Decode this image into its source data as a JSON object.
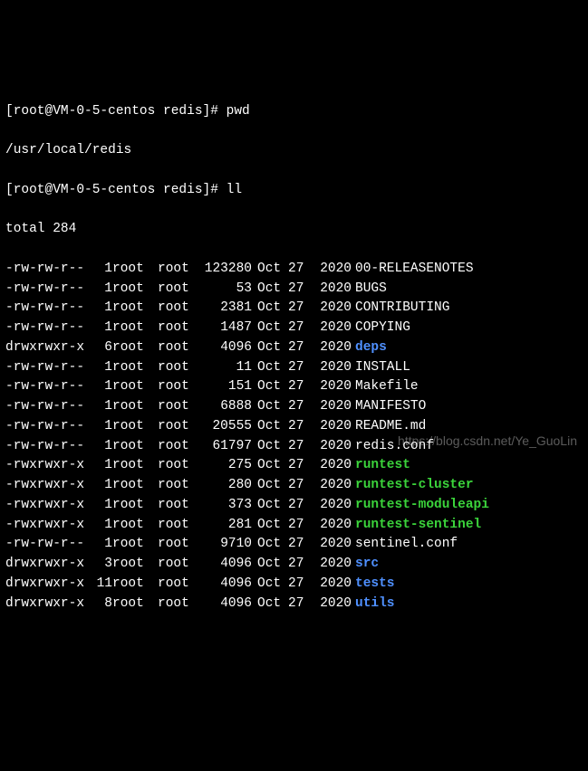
{
  "prompt1": {
    "text": "[root@VM-0-5-centos redis]# ",
    "cmd": "pwd"
  },
  "pwd_output": "/usr/local/redis",
  "prompt2": {
    "text": "[root@VM-0-5-centos redis]# ",
    "cmd": "ll"
  },
  "total_line": "total 284",
  "rows": [
    {
      "perms": "-rw-rw-r--",
      "links": "1",
      "owner": "root",
      "group": "root",
      "size": "123280",
      "month": "Oct",
      "day": "27",
      "year": "2020",
      "name": "00-RELEASENOTES",
      "type": "file"
    },
    {
      "perms": "-rw-rw-r--",
      "links": "1",
      "owner": "root",
      "group": "root",
      "size": "53",
      "month": "Oct",
      "day": "27",
      "year": "2020",
      "name": "BUGS",
      "type": "file"
    },
    {
      "perms": "-rw-rw-r--",
      "links": "1",
      "owner": "root",
      "group": "root",
      "size": "2381",
      "month": "Oct",
      "day": "27",
      "year": "2020",
      "name": "CONTRIBUTING",
      "type": "file"
    },
    {
      "perms": "-rw-rw-r--",
      "links": "1",
      "owner": "root",
      "group": "root",
      "size": "1487",
      "month": "Oct",
      "day": "27",
      "year": "2020",
      "name": "COPYING",
      "type": "file"
    },
    {
      "perms": "drwxrwxr-x",
      "links": "6",
      "owner": "root",
      "group": "root",
      "size": "4096",
      "month": "Oct",
      "day": "27",
      "year": "2020",
      "name": "deps",
      "type": "dir"
    },
    {
      "perms": "-rw-rw-r--",
      "links": "1",
      "owner": "root",
      "group": "root",
      "size": "11",
      "month": "Oct",
      "day": "27",
      "year": "2020",
      "name": "INSTALL",
      "type": "file"
    },
    {
      "perms": "-rw-rw-r--",
      "links": "1",
      "owner": "root",
      "group": "root",
      "size": "151",
      "month": "Oct",
      "day": "27",
      "year": "2020",
      "name": "Makefile",
      "type": "file"
    },
    {
      "perms": "-rw-rw-r--",
      "links": "1",
      "owner": "root",
      "group": "root",
      "size": "6888",
      "month": "Oct",
      "day": "27",
      "year": "2020",
      "name": "MANIFESTO",
      "type": "file"
    },
    {
      "perms": "-rw-rw-r--",
      "links": "1",
      "owner": "root",
      "group": "root",
      "size": "20555",
      "month": "Oct",
      "day": "27",
      "year": "2020",
      "name": "README.md",
      "type": "file"
    },
    {
      "perms": "-rw-rw-r--",
      "links": "1",
      "owner": "root",
      "group": "root",
      "size": "61797",
      "month": "Oct",
      "day": "27",
      "year": "2020",
      "name": "redis.conf",
      "type": "file"
    },
    {
      "perms": "-rwxrwxr-x",
      "links": "1",
      "owner": "root",
      "group": "root",
      "size": "275",
      "month": "Oct",
      "day": "27",
      "year": "2020",
      "name": "runtest",
      "type": "exec"
    },
    {
      "perms": "-rwxrwxr-x",
      "links": "1",
      "owner": "root",
      "group": "root",
      "size": "280",
      "month": "Oct",
      "day": "27",
      "year": "2020",
      "name": "runtest-cluster",
      "type": "exec"
    },
    {
      "perms": "-rwxrwxr-x",
      "links": "1",
      "owner": "root",
      "group": "root",
      "size": "373",
      "month": "Oct",
      "day": "27",
      "year": "2020",
      "name": "runtest-moduleapi",
      "type": "exec"
    },
    {
      "perms": "-rwxrwxr-x",
      "links": "1",
      "owner": "root",
      "group": "root",
      "size": "281",
      "month": "Oct",
      "day": "27",
      "year": "2020",
      "name": "runtest-sentinel",
      "type": "exec"
    },
    {
      "perms": "-rw-rw-r--",
      "links": "1",
      "owner": "root",
      "group": "root",
      "size": "9710",
      "month": "Oct",
      "day": "27",
      "year": "2020",
      "name": "sentinel.conf",
      "type": "file"
    },
    {
      "perms": "drwxrwxr-x",
      "links": "3",
      "owner": "root",
      "group": "root",
      "size": "4096",
      "month": "Oct",
      "day": "27",
      "year": "2020",
      "name": "src",
      "type": "dir"
    },
    {
      "perms": "drwxrwxr-x",
      "links": "11",
      "owner": "root",
      "group": "root",
      "size": "4096",
      "month": "Oct",
      "day": "27",
      "year": "2020",
      "name": "tests",
      "type": "dir"
    },
    {
      "perms": "drwxrwxr-x",
      "links": "8",
      "owner": "root",
      "group": "root",
      "size": "4096",
      "month": "Oct",
      "day": "27",
      "year": "2020",
      "name": "utils",
      "type": "dir"
    }
  ],
  "watermark": "https://blog.csdn.net/Ye_GuoLin"
}
